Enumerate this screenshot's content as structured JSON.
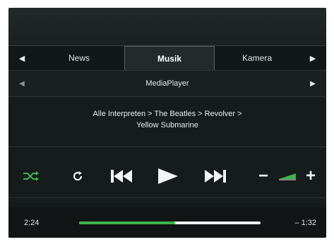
{
  "tabs": {
    "items": [
      {
        "label": "News",
        "active": false
      },
      {
        "label": "Musik",
        "active": true
      },
      {
        "label": "Kamera",
        "active": false
      }
    ]
  },
  "source": {
    "label": "MediaPlayer"
  },
  "track": {
    "breadcrumb_line1": "Alle Interpreten > The Beatles > Revolver >",
    "breadcrumb_line2": "Yellow Submarine"
  },
  "controls": {
    "icons": [
      "shuffle-icon",
      "repeat-icon",
      "previous-track-icon",
      "play-icon",
      "next-track-icon",
      "volume-down-icon",
      "volume-level-icon",
      "volume-up-icon"
    ],
    "volume_minus": "−",
    "volume_plus": "+"
  },
  "playback": {
    "elapsed": "2:24",
    "remaining": "– 1:32",
    "progress_fraction": 0.53
  },
  "colors": {
    "accent": "#3cb44a",
    "background": "#161b1b",
    "text": "#e8ecec"
  }
}
